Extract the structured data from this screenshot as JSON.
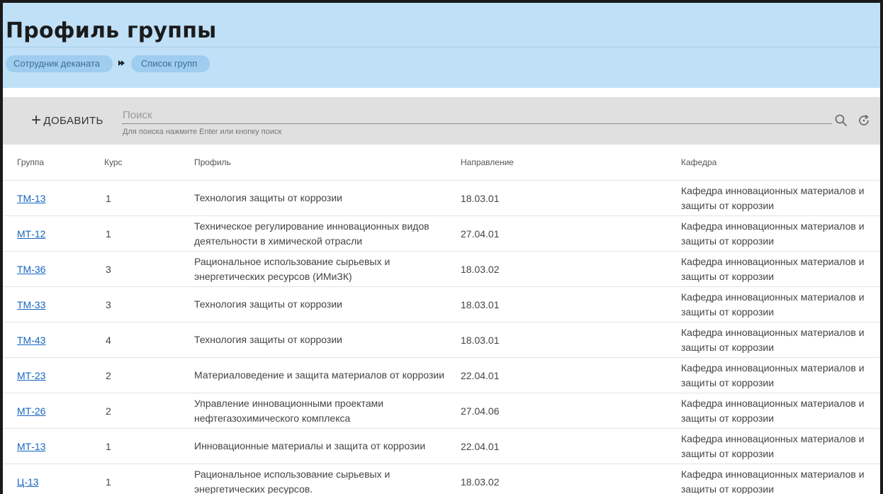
{
  "header": {
    "title": "Профиль группы",
    "breadcrumb": [
      "Сотрудник деканата",
      "Список групп"
    ]
  },
  "toolbar": {
    "add_label": "ДОБАВИТЬ",
    "search_placeholder": "Поиск",
    "search_hint": "Для поиска нажмите Enter или кнопку поиск",
    "icons": [
      "search-icon",
      "refresh-icon"
    ]
  },
  "table": {
    "columns": [
      "Группа",
      "Курс",
      "Профиль",
      "Направление",
      "Кафедра"
    ],
    "rows": [
      {
        "group": "ТМ-13",
        "course": "1",
        "profile": "Технология защиты от коррозии",
        "direction": "18.03.01",
        "department": "Кафедра инновационных материалов и защиты от коррозии"
      },
      {
        "group": "МТ-12",
        "course": "1",
        "profile": "Техническое регулирование инновационных видов деятельности в химической отрасли",
        "direction": "27.04.01",
        "department": "Кафедра инновационных материалов и защиты от коррозии"
      },
      {
        "group": "ТМ-36",
        "course": "3",
        "profile": "Рациональное использование сырьевых и энергетических ресурсов (ИМиЗК)",
        "direction": "18.03.02",
        "department": "Кафедра инновационных материалов и защиты от коррозии"
      },
      {
        "group": "ТМ-33",
        "course": "3",
        "profile": "Технология защиты от коррозии",
        "direction": "18.03.01",
        "department": "Кафедра инновационных материалов и защиты от коррозии"
      },
      {
        "group": "ТМ-43",
        "course": "4",
        "profile": "Технология защиты от коррозии",
        "direction": "18.03.01",
        "department": "Кафедра инновационных материалов и защиты от коррозии"
      },
      {
        "group": "МТ-23",
        "course": "2",
        "profile": "Материаловедение и защита материалов от коррозии",
        "direction": "22.04.01",
        "department": "Кафедра инновационных материалов и защиты от коррозии"
      },
      {
        "group": "МТ-26",
        "course": "2",
        "profile": "Управление инновационными проектами нефтегазохимического комплекса",
        "direction": "27.04.06",
        "department": "Кафедра инновационных материалов и защиты от коррозии"
      },
      {
        "group": "МТ-13",
        "course": "1",
        "profile": "Инновационные материалы и защита от коррозии",
        "direction": "22.04.01",
        "department": "Кафедра инновационных материалов и защиты от коррозии"
      },
      {
        "group": "Ц-13",
        "course": "1",
        "profile": "Рациональное использование сырьевых и энергетических ресурсов.",
        "direction": "18.03.02",
        "department": "Кафедра инновационных материалов и защиты от коррозии"
      }
    ]
  }
}
